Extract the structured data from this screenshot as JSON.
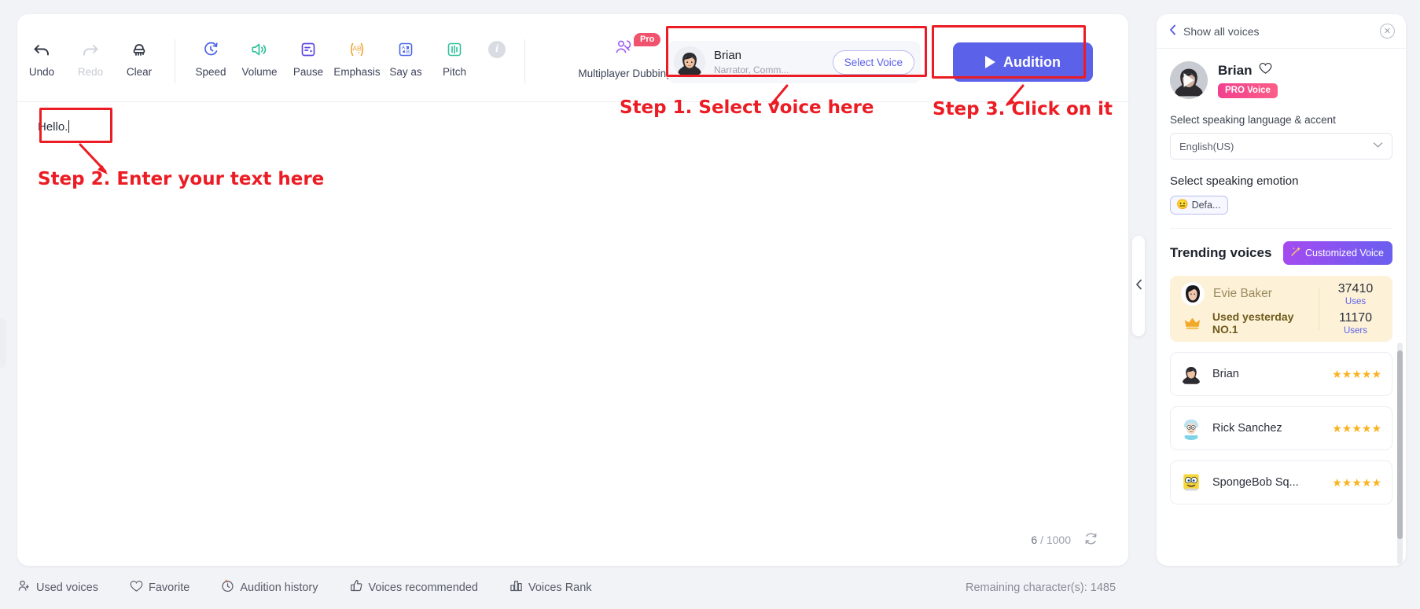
{
  "toolbar": {
    "tools": [
      {
        "label": "Undo",
        "icon": "undo-icon",
        "disabled": false
      },
      {
        "label": "Redo",
        "icon": "redo-icon",
        "disabled": true
      },
      {
        "label": "Clear",
        "icon": "clear-brush-icon",
        "disabled": false
      }
    ],
    "effects": [
      {
        "label": "Speed",
        "icon": "speed-icon",
        "color": "#4a63e7"
      },
      {
        "label": "Volume",
        "icon": "volume-icon",
        "color": "#2fc19a"
      },
      {
        "label": "Pause",
        "icon": "pause-icon",
        "color": "#5b45e0"
      },
      {
        "label": "Emphasis",
        "icon": "emphasis-icon",
        "color": "#f0a132"
      },
      {
        "label": "Say as",
        "icon": "say-as-icon",
        "color": "#4a63e7"
      },
      {
        "label": "Pitch",
        "icon": "pitch-icon",
        "color": "#2fc19a"
      }
    ],
    "info_icon": "info-icon",
    "multiplayer": {
      "label": "Multiplayer Dubbing",
      "badge": "Pro",
      "icon": "multiplayer-dubbing-icon"
    },
    "voice_chip": {
      "name": "Brian",
      "tags": "Narrator, Comm...",
      "select_label": "Select Voice",
      "avatar": "brian-avatar"
    },
    "audition_label": "Audition"
  },
  "editor": {
    "text": "Hello.",
    "char_current": "6",
    "char_sep": "/",
    "char_max": "1000",
    "refresh_icon": "refresh-icon"
  },
  "panel": {
    "header": {
      "back_icon": "chevron-left-icon",
      "title": "Show all voices",
      "close_icon": "close-circle-icon"
    },
    "hero": {
      "name": "Brian",
      "favorite_icon": "heart-icon",
      "badge": "PRO Voice",
      "play_icon": "play-icon"
    },
    "language": {
      "label": "Select speaking language & accent",
      "value": "English(US)",
      "chevron": "chevron-down-icon"
    },
    "emotion": {
      "label": "Select speaking emotion",
      "chip_emoji": "😐",
      "chip_label": "Defa..."
    },
    "trending": {
      "title": "Trending voices",
      "custom_button": "Customized Voice",
      "custom_icon": "magic-wand-icon"
    },
    "featured": {
      "name": "Evie Baker",
      "crown_icon": "crown-icon",
      "subtitle": "Used yesterday NO.1",
      "uses_value": "37410",
      "uses_label": "Uses",
      "users_value": "11170",
      "users_label": "Users"
    },
    "voices": [
      {
        "name": "Brian",
        "stars": "★★★★★",
        "avatar": "brian-avatar"
      },
      {
        "name": "Rick Sanchez",
        "stars": "★★★★★",
        "avatar": "rick-avatar"
      },
      {
        "name": "SpongeBob Sq...",
        "stars": "★★★★★",
        "avatar": "spongebob-avatar"
      }
    ]
  },
  "bottom": {
    "items": [
      {
        "label": "Used voices",
        "icon": "used-voices-icon"
      },
      {
        "label": "Favorite",
        "icon": "heart-icon"
      },
      {
        "label": "Audition history",
        "icon": "history-clock-icon"
      },
      {
        "label": "Voices recommended",
        "icon": "thumbs-up-icon"
      },
      {
        "label": "Voices Rank",
        "icon": "bar-chart-icon"
      }
    ],
    "remaining": "Remaining character(s): 1485"
  },
  "annotations": {
    "color": "#ec1c24",
    "step1": "Step 1. Select voice here",
    "step2": "Step 2. Enter your text here",
    "step3": "Step 3. Click on it"
  }
}
